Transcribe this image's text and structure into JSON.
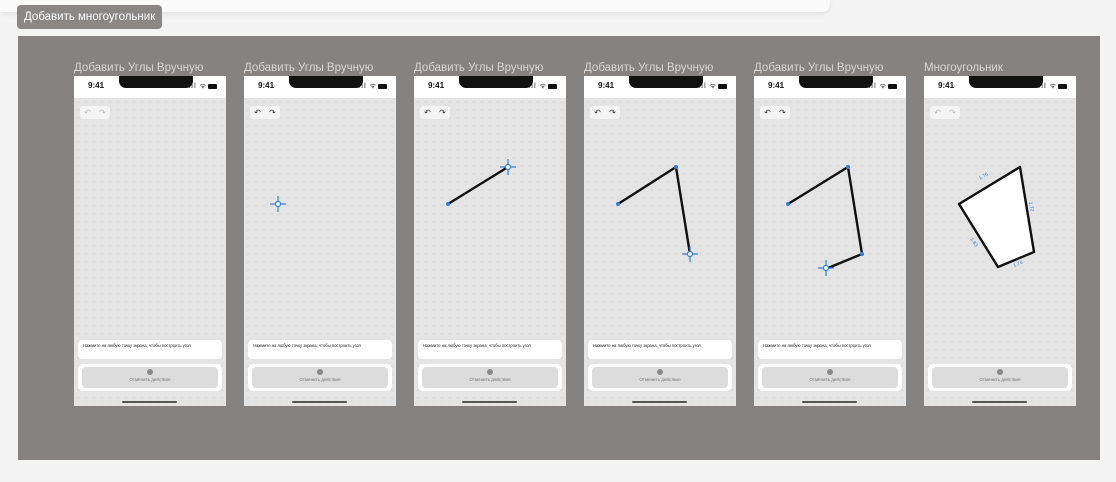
{
  "frame_tag": "Добавить многоугольник",
  "screens": [
    {
      "title": "Добавить Углы Вручную",
      "time": "9:41",
      "hint": "Нажмите на любую точку экрана, чтобы построить угол",
      "cancel_label": "Отменить действие",
      "undo_enabled": false
    },
    {
      "title": "Добавить Углы Вручную",
      "time": "9:41",
      "hint": "Нажмите на любую точку экрана, чтобы построить угол",
      "cancel_label": "Отменить действие",
      "undo_enabled": true
    },
    {
      "title": "Добавить Углы Вручную",
      "time": "9:41",
      "hint": "Нажмите на любую точку экрана, чтобы построить угол",
      "cancel_label": "Отменить действие",
      "undo_enabled": true
    },
    {
      "title": "Добавить Углы Вручную",
      "time": "9:41",
      "hint": "Нажмите на любую точку экрана, чтобы построить угол",
      "cancel_label": "Отменить действие",
      "undo_enabled": true
    },
    {
      "title": "Добавить Углы Вручную",
      "time": "9:41",
      "hint": "Нажмите на любую точку экрана, чтобы построить угол",
      "cancel_label": "Отменить действие",
      "undo_enabled": true
    },
    {
      "title": "Многоугольник",
      "time": "9:41",
      "hint": "",
      "cancel_label": "Отменить действие",
      "undo_enabled": false,
      "edge_labels": [
        "1.76",
        "1.72",
        "1.76",
        "1.83"
      ]
    }
  ],
  "colors": {
    "accent": "#2f7fd6",
    "canvas": "#858280",
    "tag": "#8a8785"
  }
}
